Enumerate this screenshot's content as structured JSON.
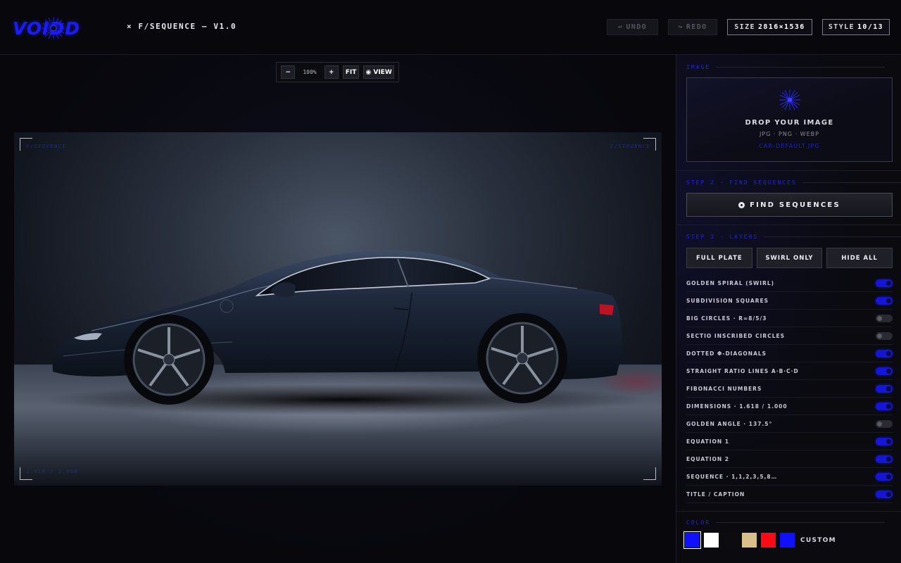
{
  "header": {
    "logo_text": "VOIDD",
    "title": "× F/SEQUENCE — V1.0",
    "undo": {
      "label": "UNDO",
      "icon": "undo-arrow-icon"
    },
    "redo": {
      "label": "REDO",
      "icon": "redo-arrow-icon"
    },
    "size": {
      "label": "SIZE",
      "value": "2816×1536"
    },
    "style": {
      "label": "STYLE",
      "value": "10/13"
    }
  },
  "zoom": {
    "minus": "−",
    "value": "100%",
    "plus": "+",
    "fit": "FIT",
    "view": "VIEW",
    "view_icon": "eye-icon"
  },
  "canvas": {
    "corner_labels": [
      "F/SEQUENCE",
      "F/SEQUENCE",
      "1.618 / 1.000"
    ]
  },
  "panel": {
    "image_section": "IMAGE",
    "dropzone": {
      "title": "DROP YOUR IMAGE",
      "formats": "JPG · PNG · WEBP",
      "file": "CAR-DEFAULT.JPG"
    },
    "step2_label": "STEP 2 · FIND SEQUENCES",
    "find_button": "FIND SEQUENCES",
    "step3_label": "STEP 3 · LAYERS",
    "presets": [
      "FULL PLATE",
      "SWIRL ONLY",
      "HIDE ALL"
    ],
    "layers": [
      {
        "label": "GOLDEN SPIRAL (SWIRL)",
        "on": true
      },
      {
        "label": "SUBDIVISION SQUARES",
        "on": true
      },
      {
        "label": "BIG CIRCLES · R=8/5/3",
        "on": false
      },
      {
        "label": "SECTIO INSCRIBED CIRCLES",
        "on": false
      },
      {
        "label": "DOTTED Φ-DIAGONALS",
        "on": true
      },
      {
        "label": "STRAIGHT RATIO LINES A·B·C·D",
        "on": true
      },
      {
        "label": "FIBONACCI NUMBERS",
        "on": true
      },
      {
        "label": "DIMENSIONS · 1.618 / 1.000",
        "on": true
      },
      {
        "label": "GOLDEN ANGLE · 137.5°",
        "on": false
      },
      {
        "label": "EQUATION 1",
        "on": true
      },
      {
        "label": "EQUATION 2",
        "on": true
      },
      {
        "label": "SEQUENCE · 1,1,2,3,5,8…",
        "on": true
      },
      {
        "label": "TITLE / CAPTION",
        "on": true
      }
    ],
    "color_label": "COLOR",
    "swatches": [
      "#1010ff",
      "#ffffff",
      "#0c0c10",
      "#d8c088",
      "#ff0a14",
      "#1010ff"
    ],
    "selected_swatch": 0,
    "custom_label": "CUSTOM"
  },
  "colors": {
    "accent": "#1a1aff",
    "toggle_on": "#1515d8",
    "toggle_off": "#2a2a32"
  }
}
